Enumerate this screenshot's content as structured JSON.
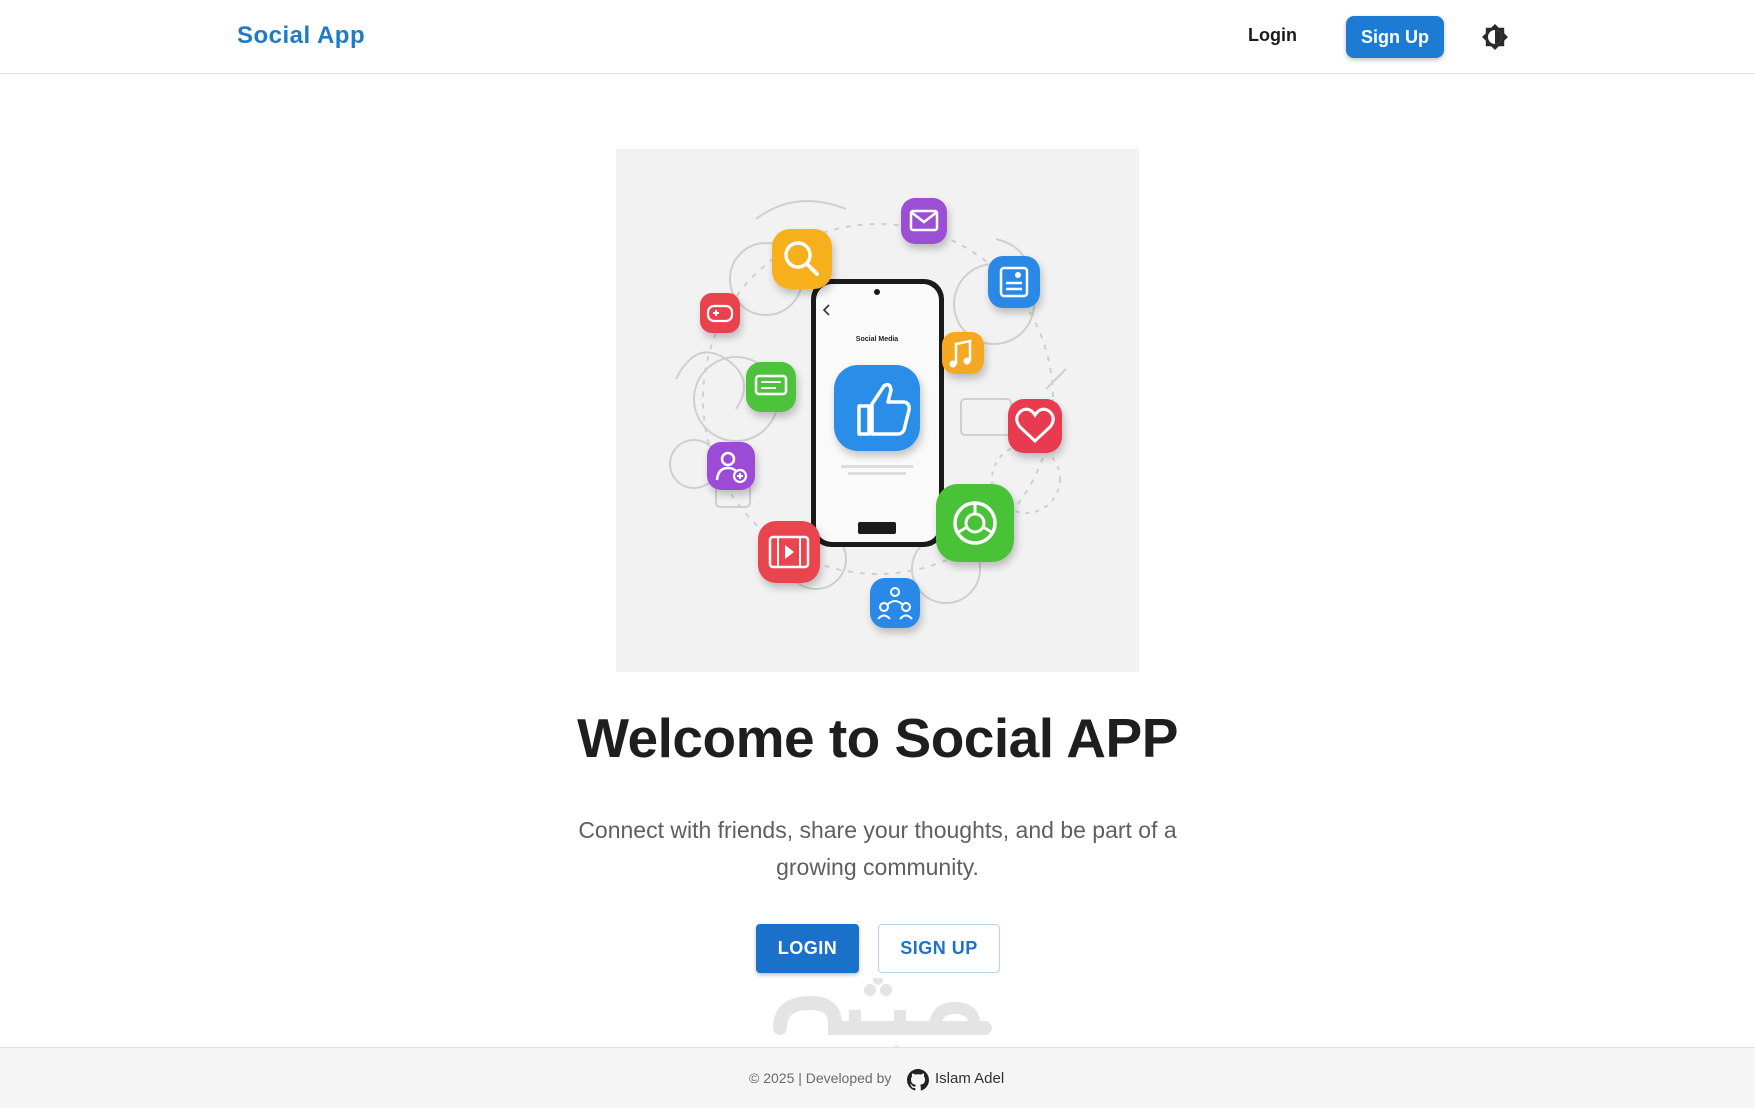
{
  "navbar": {
    "brand": "Social App",
    "login_label": "Login",
    "signup_label": "Sign Up"
  },
  "hero": {
    "phone_screen_title": "Social Media",
    "title": "Welcome to Social APP",
    "subtitle": "Connect with friends, share your thoughts, and be part of a growing community.",
    "login_button": "LOGIN",
    "signup_button": "SIGN UP"
  },
  "watermark": {
    "text": "mostaql.com"
  },
  "footer": {
    "copyright": "© 2025 | Developed by",
    "author": "Islam Adel"
  },
  "colors": {
    "primary": "#1e7bd4",
    "brand": "#1e7bc6",
    "title": "#1e1e1e",
    "muted": "#5f5f5f"
  },
  "icons": [
    "theme-toggle-icon",
    "github-icon",
    "search-icon",
    "mail-icon",
    "news-icon",
    "gamepad-icon",
    "chat-icon",
    "music-icon",
    "heart-icon",
    "add-user-icon",
    "video-icon",
    "share-icon",
    "group-icon",
    "thumbs-up-icon"
  ]
}
